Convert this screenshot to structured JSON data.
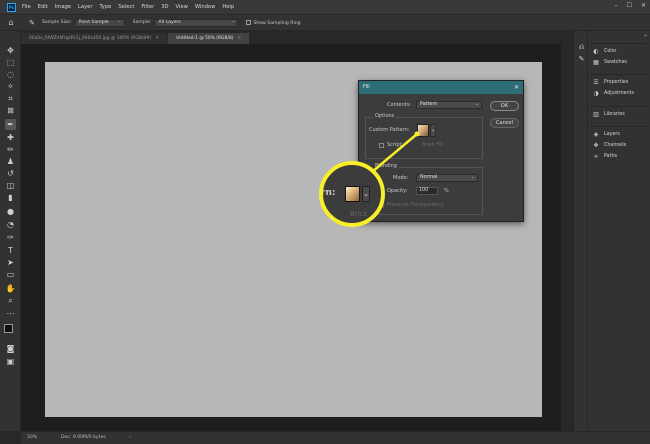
{
  "menubar": {
    "app_logo": "Ps",
    "items": [
      "File",
      "Edit",
      "Image",
      "Layer",
      "Type",
      "Select",
      "Filter",
      "3D",
      "View",
      "Window",
      "Help"
    ],
    "window_controls": [
      "–",
      "☐",
      "✕"
    ]
  },
  "options": {
    "sample_size_label": "Sample Size:",
    "sample_size_value": "Point Sample",
    "sample_label": "Sample:",
    "sample_value": "All Layers",
    "show_ring_label": "Show Sampling Ring"
  },
  "tabs": [
    {
      "label": "00a0e_fdWZANYqzFk1j_600x450.jpg @ 100% (RGB/8#)",
      "active": false
    },
    {
      "label": "Untitled-1 @ 50% (RGB/8)",
      "active": true
    }
  ],
  "panels": {
    "group1": [
      "Color",
      "Swatches"
    ],
    "group2": [
      "Properties",
      "Adjustments"
    ],
    "group3": [
      "Libraries"
    ],
    "group4": [
      "Layers",
      "Channels",
      "Paths"
    ]
  },
  "status": {
    "zoom": "50%",
    "doc": "Doc: 9.00M/0 bytes",
    "arrow": "›"
  },
  "dialog": {
    "title": "Fill",
    "contents_label": "Contents:",
    "contents_value": "Pattern",
    "ok_label": "OK",
    "cancel_label": "Cancel",
    "options_label": "Options",
    "custom_pattern_label": "Custom Pattern:",
    "script_label": "Script:",
    "script_value": "Brick Fill",
    "blending_label": "Blending",
    "mode_label": "Mode:",
    "mode_value": "Normal",
    "opacity_label": "Opacity:",
    "opacity_value": "100",
    "opacity_unit": "%",
    "preserve_label": "Preserve Transparency"
  },
  "callout": {
    "label_fragment": "rn:",
    "brick_fragment": "Brick",
    "color": "#f7ef2a"
  }
}
